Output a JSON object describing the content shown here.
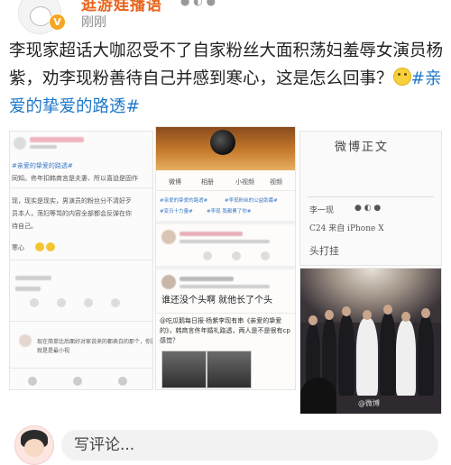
{
  "header": {
    "username": "逛游娃播语",
    "timestamp": "刚刚"
  },
  "post": {
    "text": "李现家超话大咖忍受不了自家粉丝大面积荡妇羞辱女演员杨紫，劝李现粉善待自己并感到寒心，这是怎么回事？",
    "topic": "#亲爱的挚爱的路透#"
  },
  "image1": {
    "topic_line": "#亲爱的挚爱的路透#",
    "lines": [
      "同知。佟年扣韩商言是夫妻、所以喜迫是固作",
      "现，现实是现实，男演员的粉丝分不清好歹",
      "员本人，荡妇等骂的内容全部都会反弹在你",
      "待自己。",
      "寒心"
    ],
    "comment": "现在简单比后面好对家说来的都表白的那个，你要么不的",
    "reply": "就是是最小视"
  },
  "image2": {
    "tabs": [
      "微博",
      "相册",
      "小视频",
      "视频"
    ],
    "tags": [
      "#亲爱的挚爱的路透#",
      "#李现粉丝的公益助募#",
      "#变日十力量#",
      "#李现 我都累了你#"
    ],
    "comment1": "谁还没个头啊 就他长了个头",
    "comment2": "@吃瓜鹅每日报·杨紫李现有串《亲爱的挚爱的》，韩商言佟年婚礼路透，两人是不是很有cp感觉？"
  },
  "image3": {
    "title": "微博正文",
    "line1": "李一现",
    "line2": "C24 来自 iPhone X",
    "line3": "头打挂"
  },
  "image4": {
    "watermark": "@微博"
  },
  "comment_bar": {
    "placeholder": "写评论..."
  },
  "colors": {
    "username": "#e8641b",
    "topic": "#1f78c9",
    "badge": "#f5a623"
  }
}
